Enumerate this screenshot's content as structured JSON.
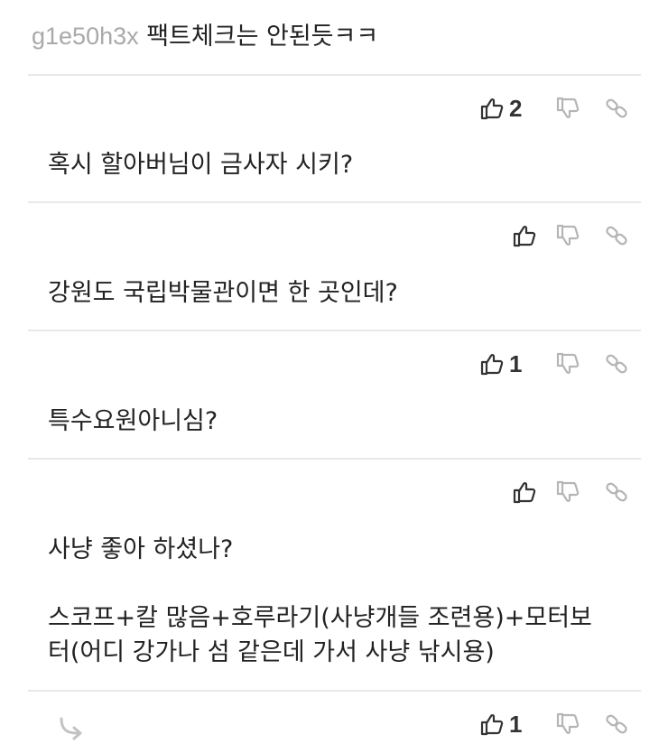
{
  "top_comment": {
    "username": "g1e50h3x",
    "text": "팩트체크는 안된듯ㅋㅋ"
  },
  "comments": [
    {
      "likes": "2",
      "text_lines": [
        "혹시 할아버님이 금사자 시키?"
      ]
    },
    {
      "likes": "",
      "text_lines": [
        "강원도 국립박물관이면 한 곳인데?"
      ]
    },
    {
      "likes": "1",
      "text_lines": [
        "특수요원아니심?"
      ]
    },
    {
      "likes": "",
      "text_lines": [
        "사냥 좋아 하셨나?",
        "",
        "스코프+칼 많음+호루라기(사냥개들 조련용)+모터보",
        "터(어디 강가나 섬 같은데 가서 사냥 낚시용)"
      ]
    },
    {
      "likes": "1",
      "text_lines": []
    }
  ],
  "icons": {
    "like": "thumbs-up-icon",
    "dislike": "thumbs-down-icon",
    "link": "link-icon",
    "reply": "reply-arrow-icon"
  },
  "colors": {
    "icon_active": "#333333",
    "icon_muted": "#b5b5b5",
    "username": "#a9a9a9",
    "divider": "#e8e8e8"
  }
}
